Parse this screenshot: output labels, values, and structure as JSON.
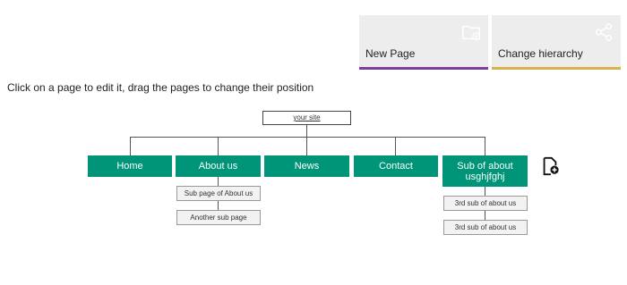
{
  "toolbar": {
    "new_page": {
      "label": "New Page",
      "icon": "folder-add-icon",
      "accent": "#7b3f9e"
    },
    "change_hierarchy": {
      "label": "Change hierarchy",
      "icon": "share-icon",
      "accent": "#d4b24c"
    }
  },
  "instruction": "Click on a page to edit it, drag the pages to change their position",
  "root": {
    "label": "your site"
  },
  "pages": [
    {
      "label": "Home",
      "children": []
    },
    {
      "label": "About us",
      "children": [
        "Sub page of About us",
        "Another sub page"
      ]
    },
    {
      "label": "News",
      "children": []
    },
    {
      "label": "Contact",
      "children": []
    },
    {
      "label": "Sub of about usghjfghj",
      "children": [
        "3rd sub of about us",
        "3rd sub of about us"
      ]
    }
  ],
  "colors": {
    "page": "#009578"
  },
  "add_page_icon": "add-page-icon"
}
